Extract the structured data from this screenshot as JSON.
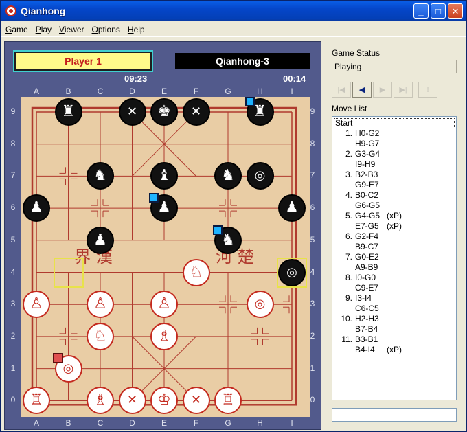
{
  "window": {
    "title": "Qianhong"
  },
  "menu": [
    {
      "key": "G",
      "rest": "ame"
    },
    {
      "key": "P",
      "rest": "lay"
    },
    {
      "key": "V",
      "rest": "iewer"
    },
    {
      "key": "O",
      "rest": "ptions"
    },
    {
      "key": "H",
      "rest": "elp"
    }
  ],
  "players": {
    "player1": "Player 1",
    "player2": "Qianhong-3"
  },
  "clocks": {
    "player1": "09:23",
    "player2": "00:14"
  },
  "board": {
    "files": [
      "A",
      "B",
      "C",
      "D",
      "E",
      "F",
      "G",
      "H",
      "I"
    ],
    "ranks": [
      "9",
      "8",
      "7",
      "6",
      "5",
      "4",
      "3",
      "2",
      "1",
      "0"
    ],
    "river_left": "界  漢",
    "river_right": "河  楚",
    "colors": {
      "board": "#e9cda5",
      "lines": "#b03a2e",
      "black_piece": "#111111",
      "red_piece": "#c42a1f",
      "last_move": "#1eb4ff",
      "selection": "#e05050"
    },
    "pieces": [
      {
        "file": 1,
        "rank": 9,
        "side": "black",
        "type": "rook-icon",
        "glyph": "♜"
      },
      {
        "file": 3,
        "rank": 9,
        "side": "black",
        "type": "advisor-icon",
        "glyph": "✕"
      },
      {
        "file": 4,
        "rank": 9,
        "side": "black",
        "type": "king-icon",
        "glyph": "♚"
      },
      {
        "file": 5,
        "rank": 9,
        "side": "black",
        "type": "advisor-icon",
        "glyph": "✕"
      },
      {
        "file": 7,
        "rank": 9,
        "side": "black",
        "type": "rook-icon",
        "glyph": "♜"
      },
      {
        "file": 2,
        "rank": 7,
        "side": "black",
        "type": "horse-icon",
        "glyph": "♞"
      },
      {
        "file": 4,
        "rank": 7,
        "side": "black",
        "type": "elephant-icon",
        "glyph": "♝"
      },
      {
        "file": 6,
        "rank": 7,
        "side": "black",
        "type": "horse-icon",
        "glyph": "♞"
      },
      {
        "file": 7,
        "rank": 7,
        "side": "black",
        "type": "cannon-icon",
        "glyph": "◎"
      },
      {
        "file": 0,
        "rank": 6,
        "side": "black",
        "type": "pawn-icon",
        "glyph": "♟"
      },
      {
        "file": 4,
        "rank": 6,
        "side": "black",
        "type": "pawn-icon",
        "glyph": "♟"
      },
      {
        "file": 8,
        "rank": 6,
        "side": "black",
        "type": "pawn-icon",
        "glyph": "♟"
      },
      {
        "file": 2,
        "rank": 5,
        "side": "black",
        "type": "pawn-icon",
        "glyph": "♟"
      },
      {
        "file": 6,
        "rank": 5,
        "side": "black",
        "type": "horse-icon",
        "glyph": "♞"
      },
      {
        "file": 8,
        "rank": 4,
        "side": "black",
        "type": "cannon-icon",
        "glyph": "◎"
      },
      {
        "file": 5,
        "rank": 4,
        "side": "red",
        "type": "horse-icon",
        "glyph": "♘"
      },
      {
        "file": 0,
        "rank": 3,
        "side": "red",
        "type": "pawn-icon",
        "glyph": "♙"
      },
      {
        "file": 2,
        "rank": 3,
        "side": "red",
        "type": "pawn-icon",
        "glyph": "♙"
      },
      {
        "file": 4,
        "rank": 3,
        "side": "red",
        "type": "pawn-icon",
        "glyph": "♙"
      },
      {
        "file": 7,
        "rank": 3,
        "side": "red",
        "type": "cannon-icon",
        "glyph": "◎"
      },
      {
        "file": 2,
        "rank": 2,
        "side": "red",
        "type": "horse-icon",
        "glyph": "♘"
      },
      {
        "file": 4,
        "rank": 2,
        "side": "red",
        "type": "elephant-icon",
        "glyph": "♗"
      },
      {
        "file": 1,
        "rank": 1,
        "side": "red",
        "type": "cannon-icon",
        "glyph": "◎"
      },
      {
        "file": 0,
        "rank": 0,
        "side": "red",
        "type": "rook-icon",
        "glyph": "♖"
      },
      {
        "file": 2,
        "rank": 0,
        "side": "red",
        "type": "elephant-icon",
        "glyph": "♗"
      },
      {
        "file": 3,
        "rank": 0,
        "side": "red",
        "type": "advisor-icon",
        "glyph": "✕"
      },
      {
        "file": 4,
        "rank": 0,
        "side": "red",
        "type": "king-icon",
        "glyph": "♔"
      },
      {
        "file": 5,
        "rank": 0,
        "side": "red",
        "type": "advisor-icon",
        "glyph": "✕"
      },
      {
        "file": 6,
        "rank": 0,
        "side": "red",
        "type": "rook-icon",
        "glyph": "♖"
      }
    ],
    "last_move_markers": [
      {
        "file": 7,
        "rank": 9
      },
      {
        "file": 4,
        "rank": 6
      },
      {
        "file": 6,
        "rank": 5
      }
    ],
    "selection_marker": {
      "file": 1,
      "rank": 1
    },
    "highlight_squares": [
      {
        "file": 1,
        "rank": 4
      },
      {
        "file": 8,
        "rank": 4
      }
    ]
  },
  "side": {
    "status_label": "Game Status",
    "status_value": "Playing",
    "nav_buttons": [
      "first-move-icon",
      "prev-move-icon",
      "next-move-icon",
      "last-move-icon",
      "hint-icon"
    ],
    "movelist_label": "Move List",
    "start_label": "Start",
    "moves": [
      {
        "num": "1.",
        "red": "H0-G2",
        "red_note": "",
        "black": "H9-G7",
        "black_note": ""
      },
      {
        "num": "2.",
        "red": "G3-G4",
        "red_note": "",
        "black": "I9-H9",
        "black_note": ""
      },
      {
        "num": "3.",
        "red": "B2-B3",
        "red_note": "",
        "black": "G9-E7",
        "black_note": ""
      },
      {
        "num": "4.",
        "red": "B0-C2",
        "red_note": "",
        "black": "G6-G5",
        "black_note": ""
      },
      {
        "num": "5.",
        "red": "G4-G5",
        "red_note": "(xP)",
        "black": "E7-G5",
        "black_note": "(xP)"
      },
      {
        "num": "6.",
        "red": "G2-F4",
        "red_note": "",
        "black": "B9-C7",
        "black_note": ""
      },
      {
        "num": "7.",
        "red": "G0-E2",
        "red_note": "",
        "black": "A9-B9",
        "black_note": ""
      },
      {
        "num": "8.",
        "red": "I0-G0",
        "red_note": "",
        "black": "C9-E7",
        "black_note": ""
      },
      {
        "num": "9.",
        "red": "I3-I4",
        "red_note": "",
        "black": "C6-C5",
        "black_note": ""
      },
      {
        "num": "10.",
        "red": "H2-H3",
        "red_note": "",
        "black": "B7-B4",
        "black_note": ""
      },
      {
        "num": "11.",
        "red": "B3-B1",
        "red_note": "",
        "black": "B4-I4",
        "black_note": "(xP)"
      }
    ]
  }
}
